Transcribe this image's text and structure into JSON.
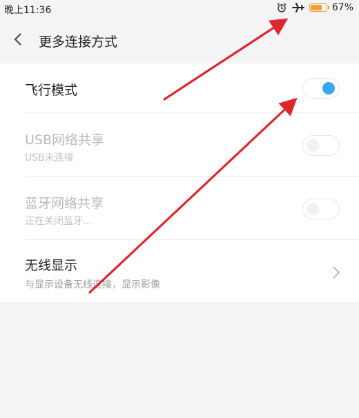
{
  "status_bar": {
    "time": "晚上11:36",
    "battery_percent_text": "67%",
    "battery_level": 0.67,
    "icons": [
      "alarm-icon",
      "airplane-icon",
      "battery-icon"
    ]
  },
  "header": {
    "title": "更多连接方式",
    "back_icon": "chevron-left-icon"
  },
  "settings": [
    {
      "label": "飞行模式",
      "sub": "",
      "control": "toggle",
      "state": "on",
      "enabled": true
    },
    {
      "label": "USB网络共享",
      "sub": "USB未连接",
      "control": "toggle",
      "state": "off",
      "enabled": false
    },
    {
      "label": "蓝牙网络共享",
      "sub": "正在关闭蓝牙...",
      "control": "toggle",
      "state": "off",
      "enabled": false
    },
    {
      "label": "无线显示",
      "sub": "与显示设备无线连接，显示影像",
      "control": "chevron",
      "enabled": true
    }
  ],
  "colors": {
    "accent_blue": "#38a6f2",
    "annotation_red": "#e0252c",
    "battery_orange": "#f0a030"
  }
}
